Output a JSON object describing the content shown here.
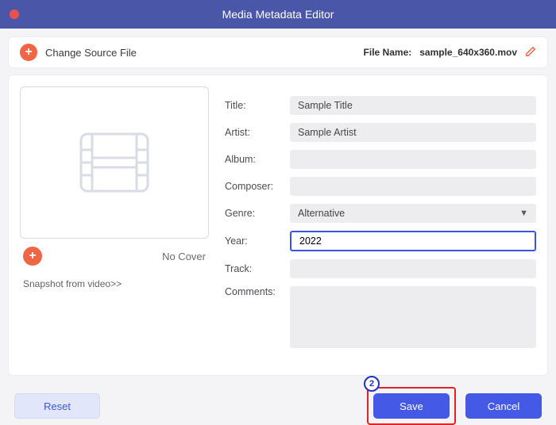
{
  "window": {
    "title": "Media Metadata Editor"
  },
  "header": {
    "change_source": "Change Source File",
    "filename_label": "File Name:",
    "filename_value": "sample_640x360.mov"
  },
  "cover": {
    "nocover": "No Cover",
    "snapshot": "Snapshot from video>>"
  },
  "fields": {
    "title_label": "Title:",
    "title_value": "Sample Title",
    "artist_label": "Artist:",
    "artist_value": "Sample Artist",
    "album_label": "Album:",
    "album_value": "",
    "composer_label": "Composer:",
    "composer_value": "",
    "genre_label": "Genre:",
    "genre_value": "Alternative",
    "year_label": "Year:",
    "year_value": "2022",
    "track_label": "Track:",
    "track_value": "",
    "comments_label": "Comments:",
    "comments_value": ""
  },
  "footer": {
    "reset": "Reset",
    "save": "Save",
    "cancel": "Cancel",
    "callout_num": "2"
  }
}
